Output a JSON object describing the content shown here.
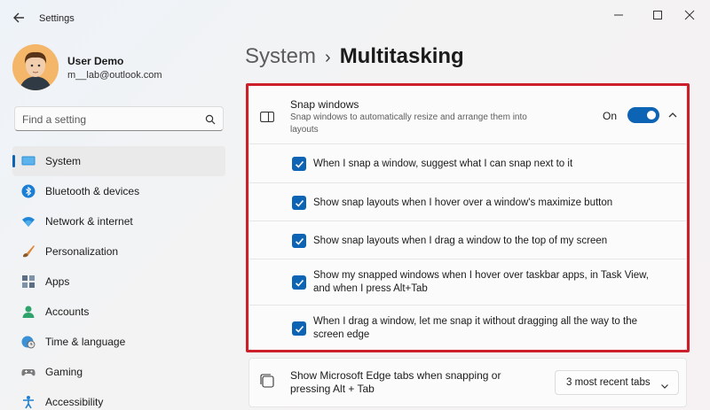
{
  "window": {
    "title": "Settings"
  },
  "user": {
    "name": "User Demo",
    "email": "m__lab@outlook.com"
  },
  "search": {
    "placeholder": "Find a setting"
  },
  "nav": {
    "items": [
      {
        "label": "System",
        "icon": "monitor-icon",
        "active": true
      },
      {
        "label": "Bluetooth & devices",
        "icon": "bluetooth-icon"
      },
      {
        "label": "Network & internet",
        "icon": "wifi-icon"
      },
      {
        "label": "Personalization",
        "icon": "brush-icon"
      },
      {
        "label": "Apps",
        "icon": "apps-icon"
      },
      {
        "label": "Accounts",
        "icon": "person-icon"
      },
      {
        "label": "Time & language",
        "icon": "globe-clock-icon"
      },
      {
        "label": "Gaming",
        "icon": "gamepad-icon"
      },
      {
        "label": "Accessibility",
        "icon": "accessibility-icon"
      }
    ]
  },
  "breadcrumb": {
    "parent": "System",
    "separator": "›",
    "current": "Multitasking"
  },
  "snap": {
    "title": "Snap windows",
    "description": "Snap windows to automatically resize and arrange them into layouts",
    "toggle_state": "On",
    "toggle_on": true,
    "options": [
      {
        "label": "When I snap a window, suggest what I can snap next to it",
        "checked": true
      },
      {
        "label": "Show snap layouts when I hover over a window's maximize button",
        "checked": true
      },
      {
        "label": "Show snap layouts when I drag a window to the top of my screen",
        "checked": true
      },
      {
        "label": "Show my snapped windows when I hover over taskbar apps, in Task View, and when I press Alt+Tab",
        "checked": true
      },
      {
        "label": "When I drag a window, let me snap it without dragging all the way to the screen edge",
        "checked": true
      }
    ]
  },
  "edge_tabs": {
    "label": "Show Microsoft Edge tabs when snapping or pressing Alt + Tab",
    "selected": "3 most recent tabs"
  },
  "colors": {
    "accent": "#0e64b4",
    "highlight": "#cc1f2a"
  }
}
